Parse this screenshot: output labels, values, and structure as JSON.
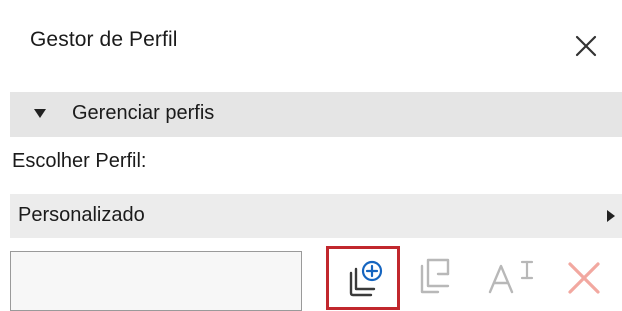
{
  "window": {
    "title": "Gestor de Perfil",
    "close_icon": "close-icon"
  },
  "section": {
    "label": "Gerenciar perfis",
    "expanded": true,
    "arrow_icon": "triangle-down-icon"
  },
  "profile": {
    "choose_label": "Escolher Perfil:",
    "selected": "Personalizado",
    "arrow_icon": "triangle-right-icon"
  },
  "name_field": {
    "value": ""
  },
  "toolbar": {
    "buttons": [
      {
        "icon": "new-profile-icon",
        "enabled": true,
        "highlighted": true
      },
      {
        "icon": "duplicate-icon",
        "enabled": false
      },
      {
        "icon": "rename-icon",
        "enabled": false
      },
      {
        "icon": "delete-icon",
        "enabled": false
      }
    ]
  },
  "colors": {
    "section_bg": "#e5e5e5",
    "select_bg": "#ececec",
    "highlight_border": "#c1272d",
    "delete_icon_disabled": "#f2a8a0",
    "disabled_icon": "#b8b8b8",
    "enabled_icon": "#3a3a3a",
    "accent_blue": "#1565c0"
  }
}
